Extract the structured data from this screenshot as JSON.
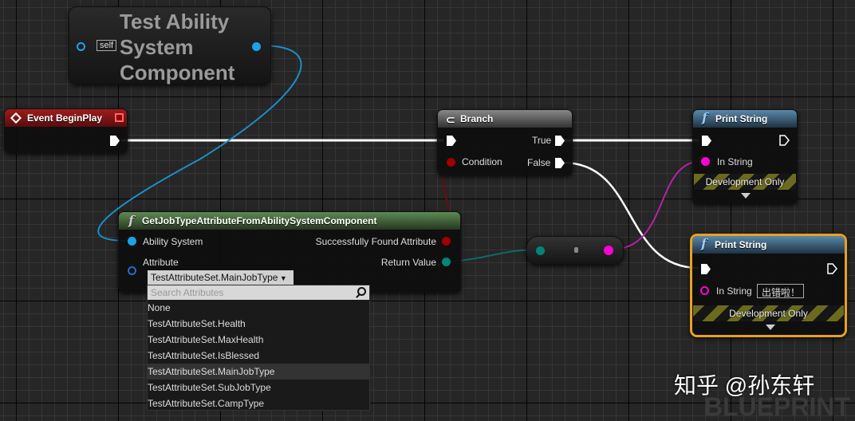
{
  "background_text": "BLUEPRINT",
  "watermark": "知乎 @孙东轩",
  "nodes": {
    "component": {
      "title": "Test Ability System Component",
      "self_label": "self"
    },
    "begin_play": {
      "title": "Event BeginPlay"
    },
    "branch": {
      "title": "Branch",
      "true_label": "True",
      "condition_label": "Condition",
      "false_label": "False"
    },
    "get_job": {
      "title": "GetJobTypeAttributeFromAbilitySystemComponent",
      "ability_label": "Ability System",
      "attribute_label": "Attribute",
      "found_label": "Successfully Found Attribute",
      "return_label": "Return Value",
      "attribute_value": "TestAttributeSet.MainJobType"
    },
    "print1": {
      "title": "Print String",
      "in_string_label": "In String",
      "dev_label": "Development Only"
    },
    "print2": {
      "title": "Print String",
      "in_string_label": "In String",
      "in_string_value": "出错啦！",
      "dev_label": "Development Only"
    }
  },
  "dropdown": {
    "search_placeholder": "Search Attributes",
    "selected": "TestAttributeSet.MainJobType",
    "items": [
      "None",
      "TestAttributeSet.Health",
      "TestAttributeSet.MaxHealth",
      "TestAttributeSet.IsBlessed",
      "TestAttributeSet.MainJobType",
      "TestAttributeSet.SubJobType",
      "TestAttributeSet.CampType"
    ]
  },
  "colors": {
    "exec": "#ffffff",
    "object": "#1aa3e8",
    "bool": "#a00000",
    "struct": "#00857a",
    "string": "#ff00d4",
    "event_header": "#8a1414",
    "function_header": "#3f6a8a",
    "pure_header": "#4a6b42",
    "selected_border": "#e8a022"
  }
}
